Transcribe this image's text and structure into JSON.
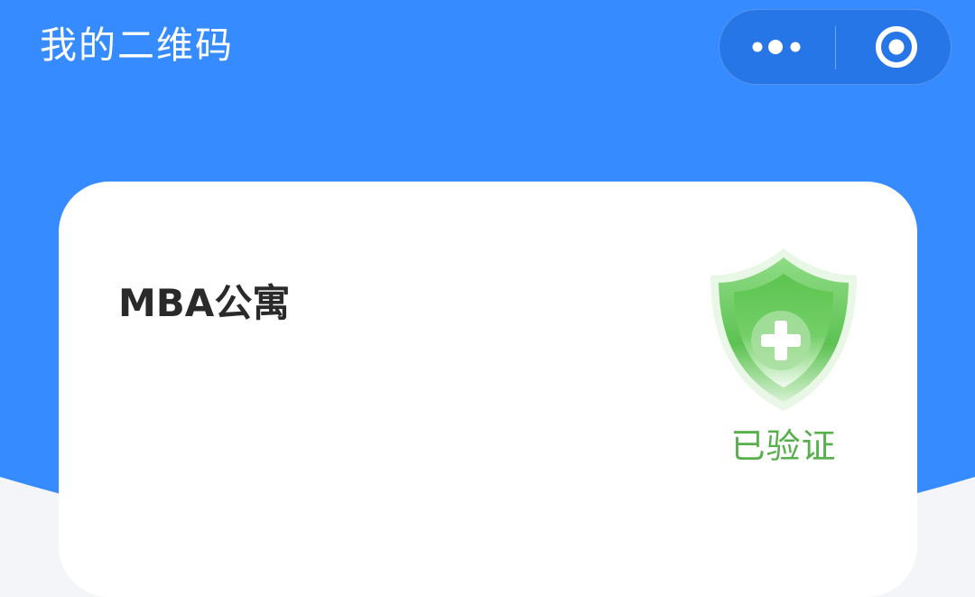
{
  "header": {
    "title": "我的二维码",
    "more_icon": "more-dots-icon",
    "close_icon": "target-circle-icon"
  },
  "card": {
    "name": "MBA公寓",
    "badge": {
      "icon": "shield-plus-icon",
      "label": "已验证"
    }
  },
  "colors": {
    "primary_blue": "#358bff",
    "card_bg": "#ffffff",
    "page_bg": "#f3f5f8",
    "verified_green": "#58b04d",
    "title_text": "#ffffff",
    "name_text": "#2a2a2a"
  }
}
